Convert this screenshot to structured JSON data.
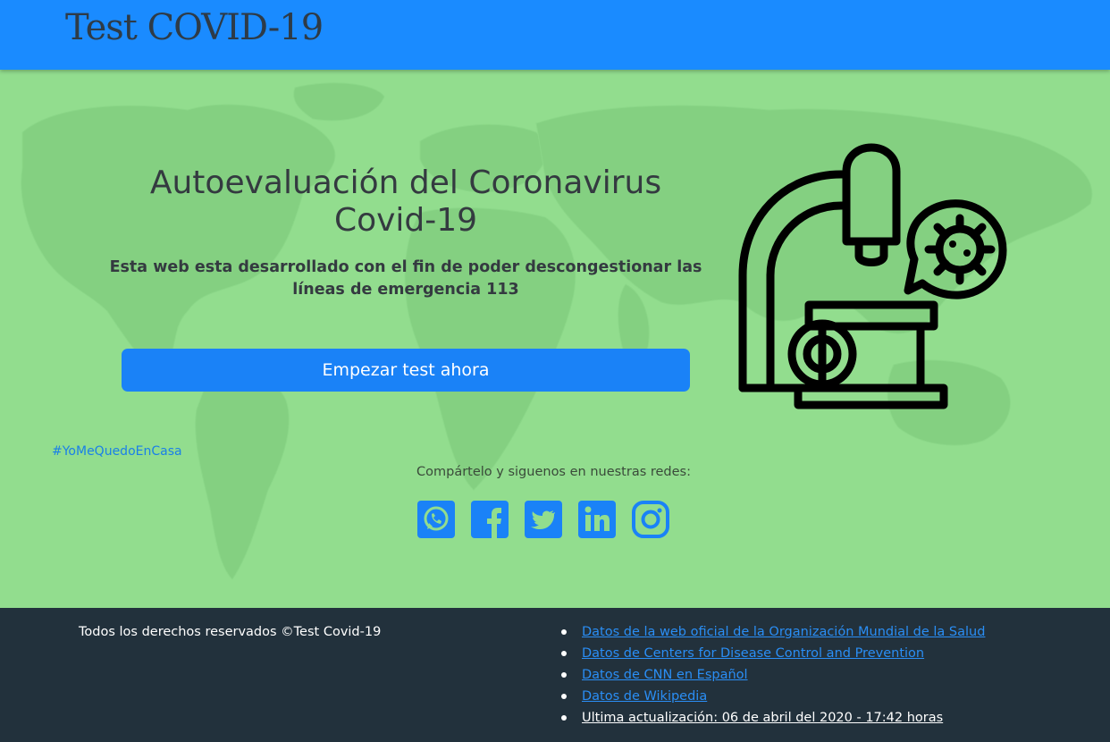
{
  "navbar": {
    "brand": "Test COVID-19"
  },
  "hero": {
    "title": "Autoevaluación del Coronavirus Covid-19",
    "subtitle_text": "Esta web esta desarrollado con el fin de poder descongestionar las líneas de emergencia",
    "subtitle_number": "113",
    "cta_label": "Empezar test ahora",
    "hashtag": "#YoMeQuedoEnCasa",
    "share_text": "Compártelo y siguenos en nuestras redes:",
    "illustration_icon": "microscope-virus-icon"
  },
  "social": [
    {
      "icon": "whatsapp-icon"
    },
    {
      "icon": "facebook-icon"
    },
    {
      "icon": "twitter-icon"
    },
    {
      "icon": "linkedin-icon"
    },
    {
      "icon": "instagram-icon"
    }
  ],
  "footer": {
    "copyright": "Todos los derechos reservados ©Test Covid-19",
    "links": [
      "Datos de la web oficial de la Organización Mundial de la Salud",
      "Datos de Centers for Disease Control and Prevention",
      "Datos de CNN en Español",
      "Datos de Wikipedia"
    ],
    "last_update": "Ultima actualización: 06 de abril del 2020 - 17:42 horas"
  },
  "colors": {
    "navbar": "#1a8bff",
    "hero_bg": "#92dd8e",
    "map": "#84d081",
    "primary": "#1a82f7",
    "footer_bg": "#22313c",
    "text_dark": "#343a40"
  }
}
